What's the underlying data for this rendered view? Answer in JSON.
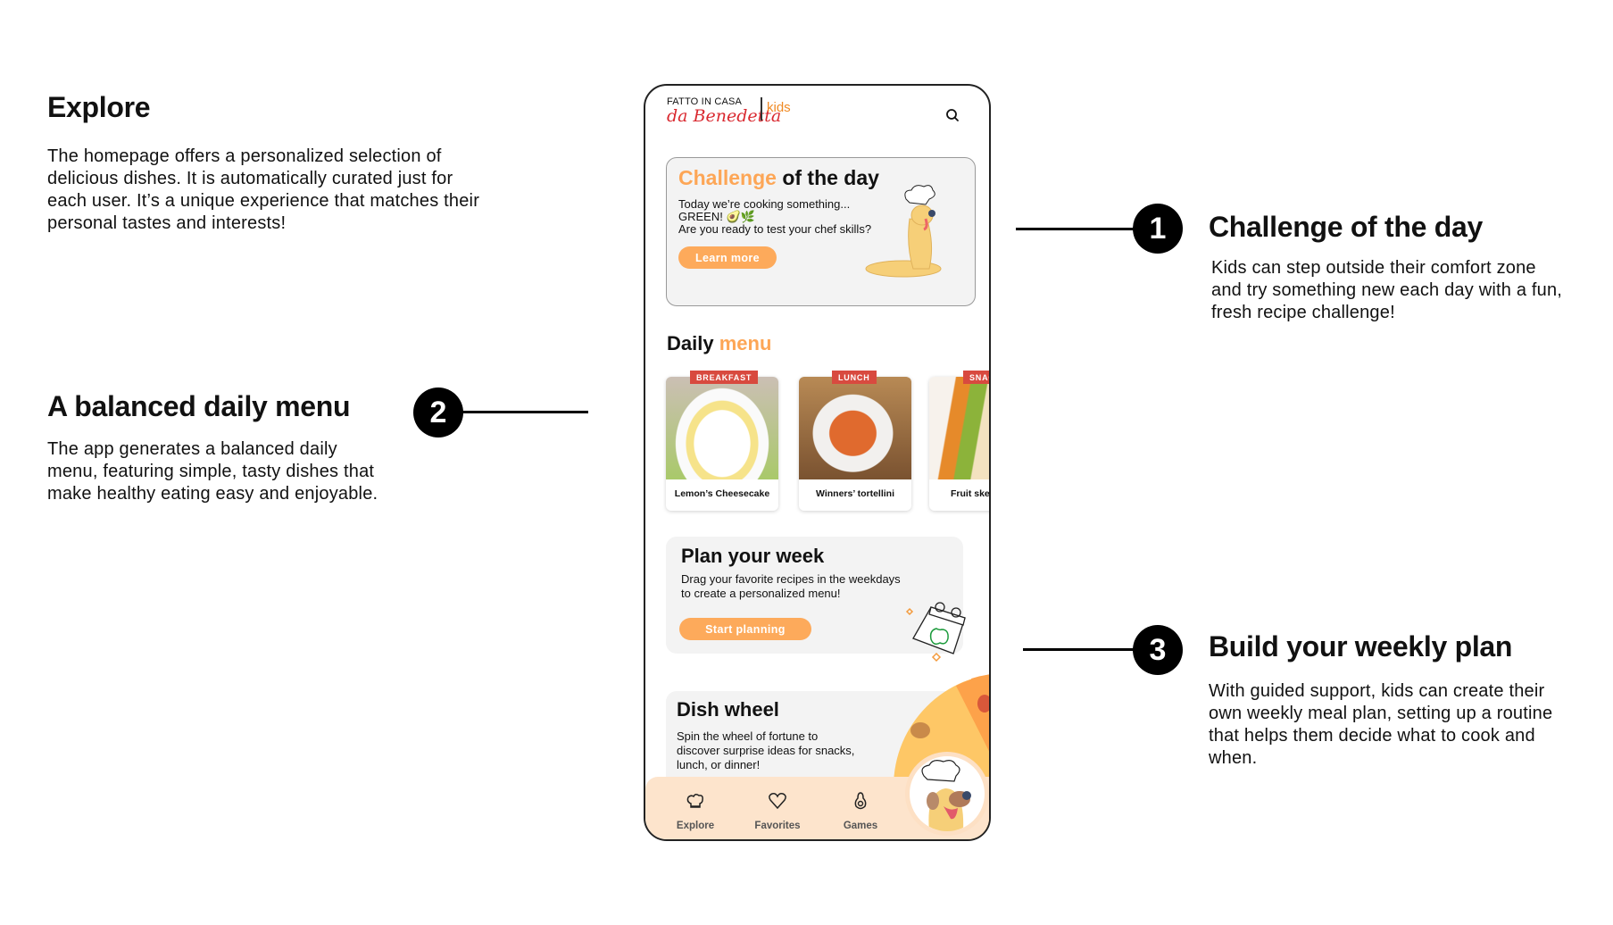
{
  "annotations": {
    "explore": {
      "title": "Explore",
      "body": "The homepage offers a personalized selection of delicious dishes. It is automatically curated just for each user. It’s a unique experience that matches their personal tastes and interests!"
    },
    "daily_menu": {
      "number": "2",
      "title": "A balanced daily menu",
      "body": "The app generates a balanced daily menu, featuring simple, tasty dishes that make healthy eating easy and enjoyable."
    },
    "challenge": {
      "number": "1",
      "title": "Challenge of the day",
      "body": "Kids can step outside their comfort zone and try something new each day with a fun, fresh recipe challenge!"
    },
    "weekly_plan": {
      "number": "3",
      "title": "Build your weekly plan",
      "body": "With guided support, kids can create their own weekly meal plan, setting up a routine that helps them decide what to cook and when."
    }
  },
  "app": {
    "logo": {
      "top": "FATTO IN CASA",
      "script": "da Benedetta",
      "sub": "kids"
    },
    "challenge_card": {
      "title_accent": "Challenge",
      "title_rest": "of the day",
      "line1": "Today we’re cooking something...",
      "line2": "GREEN! 🥑🌿",
      "line3": "Are you ready to test your chef skills?",
      "button": "Learn more"
    },
    "daily_menu": {
      "title": "Daily",
      "title_accent": "menu",
      "items": [
        {
          "tag": "BREAKFAST",
          "name": "Lemon’s Cheesecake"
        },
        {
          "tag": "LUNCH",
          "name": "Winners’ tortellini"
        },
        {
          "tag": "SNACK",
          "name": "Fruit skewers"
        }
      ]
    },
    "plan_card": {
      "title": "Plan your week",
      "line1": "Drag your favorite recipes in the weekdays",
      "line2": "to create a personalized menu!",
      "button": "Start planning"
    },
    "wheel_card": {
      "title": "Dish wheel",
      "line1": "Spin the wheel of fortune to",
      "line2": "discover surprise ideas for snacks,",
      "line3": "lunch, or dinner!"
    },
    "nav": [
      {
        "label": "Explore",
        "icon": "chef-hat-icon"
      },
      {
        "label": "Favorites",
        "icon": "heart-icon"
      },
      {
        "label": "Games",
        "icon": "avocado-icon"
      }
    ]
  },
  "colors": {
    "accent": "#fda656",
    "logo_red": "#d9282f",
    "tag_red": "#d84a3f",
    "nav_bg": "#fde4cc"
  }
}
